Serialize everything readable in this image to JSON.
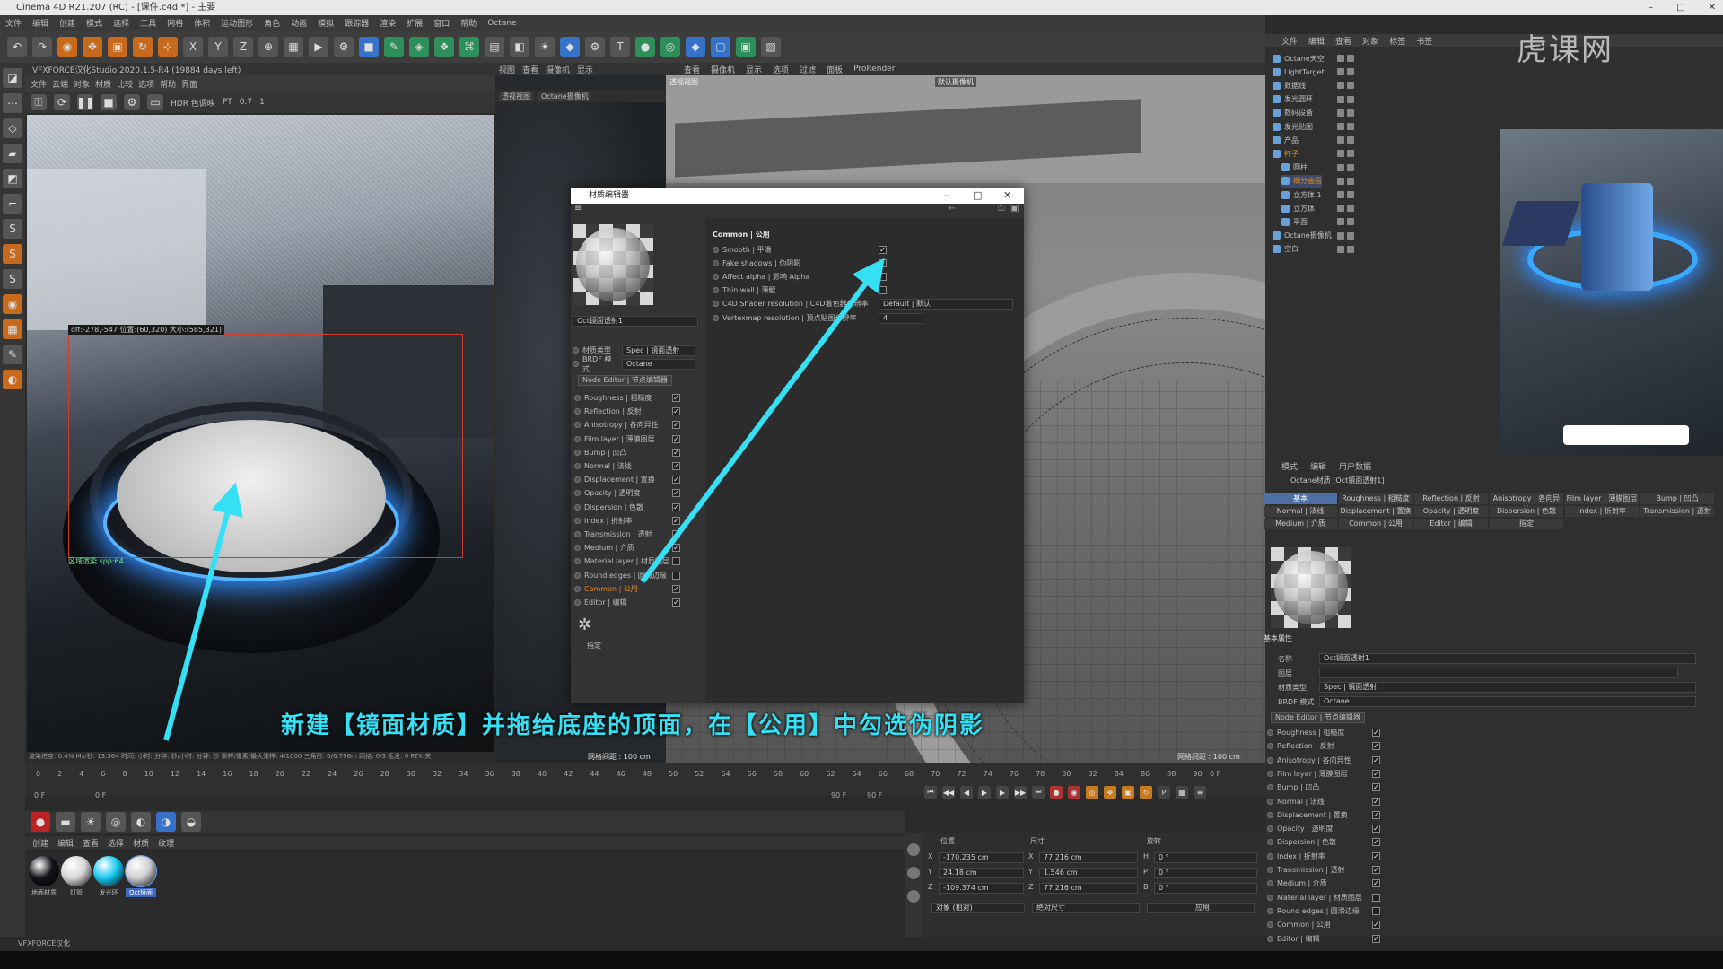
{
  "window": {
    "title": "Cinema 4D R21.207 (RC) - [课件.c4d *] - 主要"
  },
  "menubar": [
    "文件",
    "编辑",
    "创建",
    "模式",
    "选择",
    "工具",
    "网格",
    "体积",
    "运动图形",
    "角色",
    "动画",
    "模拟",
    "跟踪器",
    "渲染",
    "扩展",
    "窗口",
    "帮助",
    "Octane"
  ],
  "render_viewer": {
    "title": "VFXFORCE汉化Studio 2020.1.5-R4 (19884 days left)",
    "menu": [
      "文件",
      "云端",
      "对象",
      "材质",
      "比较",
      "选项",
      "帮助",
      "界面"
    ],
    "toolbar": {
      "hdr": "HDR 色调映",
      "mode": "PT",
      "val1": "0.7",
      "val2": "1"
    },
    "coord_tip": "off:-278,-547 位置:(60,320) 大小:(585,321)",
    "spp_label": "区域渲染 spp:64",
    "status": "渲染进度: 0.4%  Ms/秒: 13.564  时间: 小时: 分钟: 秒/小时: 分钟: 秒  采样/像素/最大采样: 4/1000  三角形: 0/6.796m  网格: 0/3  毛发: 0  RTX:关"
  },
  "viewport2": {
    "menu": [
      "查看",
      "摄像机",
      "显示"
    ],
    "tabs": [
      "透视视图",
      "Octane摄像机"
    ],
    "header": "视图"
  },
  "viewport3": {
    "menu": [
      "查看",
      "摄像机",
      "显示",
      "选项",
      "过滤",
      "面板",
      "ProRender"
    ],
    "view_label": "透视视图",
    "camera_label": "默认摄像机",
    "grid_left": "网格间距 : 100 cm",
    "grid_right": "网格间距 : 100 cm"
  },
  "timeline": {
    "ticks": [
      "0",
      "2",
      "4",
      "6",
      "8",
      "10",
      "12",
      "14",
      "16",
      "18",
      "20",
      "22",
      "24",
      "26",
      "28",
      "30",
      "32",
      "34",
      "36",
      "38",
      "40",
      "42",
      "44",
      "46",
      "48",
      "50",
      "52",
      "54",
      "56",
      "58",
      "60",
      "62",
      "64",
      "66",
      "68",
      "70",
      "72",
      "74",
      "76",
      "78",
      "80",
      "82",
      "84",
      "86",
      "88",
      "90"
    ],
    "start": "0 F",
    "cur": "0 F",
    "end1": "90 F",
    "end2": "90 F",
    "right": "0 F"
  },
  "material_mgr": {
    "menu": [
      "创建",
      "编辑",
      "查看",
      "选择",
      "材质",
      "纹理"
    ],
    "materials": [
      {
        "name": "地面材质",
        "color": "#111318"
      },
      {
        "name": "灯管",
        "color": "#d7d7d7"
      },
      {
        "name": "发光环",
        "color": "#18c8f0"
      },
      {
        "name": "Oct镜面",
        "color": "#cfcfcf"
      }
    ]
  },
  "coords": {
    "headers": [
      "位置",
      "尺寸",
      "旋转"
    ],
    "rows": [
      {
        "axis": "X",
        "pos": "-170.235 cm",
        "saxis": "X",
        "size": "77.216 cm",
        "raxis": "H",
        "rot": "0 °"
      },
      {
        "axis": "Y",
        "pos": "24.18 cm",
        "saxis": "Y",
        "size": "1.546 cm",
        "raxis": "P",
        "rot": "0 °"
      },
      {
        "axis": "Z",
        "pos": "-109.374 cm",
        "saxis": "Z",
        "size": "77.216 cm",
        "raxis": "B",
        "rot": "0 °"
      }
    ],
    "mode1": "对象 (相对)",
    "mode2": "绝对尺寸",
    "apply": "应用"
  },
  "statusbar": "VFXFORCE汉化",
  "object_mgr": {
    "menu": [
      "文件",
      "编辑",
      "查看",
      "对象",
      "标签",
      "书签"
    ],
    "objects": [
      "Octane天空",
      "LightTarget",
      "数据线",
      "发光圆环",
      "数码设备",
      "发光贴图",
      "产品",
      "杯子",
      "圆柱",
      "细分曲面",
      "立方体.1",
      "立方体",
      "平面",
      "Octane摄像机",
      "空白"
    ]
  },
  "logo": "虎课网",
  "material_editor": {
    "title": "材质编辑器",
    "name": "Oct镜面透射1",
    "type_label": "材质类型",
    "type_value": "Spec | 镜面透射",
    "brdf_label": "BRDF 模式",
    "brdf_value": "Octane",
    "node_editor": "Node Editor | 节点编辑器",
    "channels": [
      {
        "label": "Roughness | 粗糙度",
        "checked": true
      },
      {
        "label": "Reflection | 反射",
        "checked": true
      },
      {
        "label": "Anisotropy | 各向异性",
        "checked": true
      },
      {
        "label": "Film layer | 薄膜图层",
        "checked": true
      },
      {
        "label": "Bump | 凹凸",
        "checked": true
      },
      {
        "label": "Normal | 法线",
        "checked": true
      },
      {
        "label": "Displacement | 置换",
        "checked": true
      },
      {
        "label": "Opacity | 透明度",
        "checked": true
      },
      {
        "label": "Dispersion | 色散",
        "checked": true
      },
      {
        "label": "Index | 折射率",
        "checked": true
      },
      {
        "label": "Transmission | 透射",
        "checked": true
      },
      {
        "label": "Medium | 介质",
        "checked": true
      },
      {
        "label": "Material layer | 材质图层",
        "checked": false
      },
      {
        "label": "Round edges | 圆滑边缘",
        "checked": false
      },
      {
        "label": "Common | 公用",
        "checked": true
      },
      {
        "label": "Editor | 编辑",
        "checked": true
      }
    ],
    "assign_label": "指定",
    "section": "Common | 公用",
    "options": [
      {
        "label": "Smooth | 平滑",
        "checked": true
      },
      {
        "label": "Fake shadows | 伪阴影",
        "checked": true
      },
      {
        "label": "Affect alpha | 影响 Alpha",
        "checked": false
      },
      {
        "label": "Thin wall | 薄壁",
        "checked": false
      }
    ],
    "c4d_res_label": "C4D Shader resolution | C4D着色器分辨率",
    "c4d_res_value": "Default | 默认",
    "vertex_label": "Vertexmap resolution | 顶点贴图分辨率",
    "vertex_value": "4"
  },
  "attributes": {
    "menu": [
      "模式",
      "编辑",
      "用户数据"
    ],
    "title": "Octane材质 [Oct镜面透射1]",
    "tabs": [
      "基本",
      "Roughness | 粗糙度",
      "Reflection | 反射",
      "Anisotropy | 各向异性",
      "Film layer | 薄膜图层",
      "Bump | 凹凸",
      "Normal | 法线",
      "Displacement | 置换",
      "Opacity | 透明度",
      "Dispersion | 色散",
      "Index | 折射率",
      "Transmission | 透射",
      "Medium | 介质",
      "Common | 公用",
      "Editor | 编辑",
      "指定"
    ],
    "section": "基本属性",
    "name_label": "名称",
    "name_value": "Oct镜面透射1",
    "layer_label": "图层",
    "type_label": "材质类型",
    "type_value": "Spec | 镜面透射",
    "brdf_label": "BRDF 模式",
    "brdf_value": "Octane",
    "node_editor": "Node Editor | 节点编辑器"
  },
  "subtitle": "新建【镜面材质】并拖给底座的顶面，在【公用】中勾选伪阴影",
  "colors": {
    "accent": "#35e0f5",
    "selection": "#4d6fa6",
    "common_highlight": "#e08a2e"
  }
}
